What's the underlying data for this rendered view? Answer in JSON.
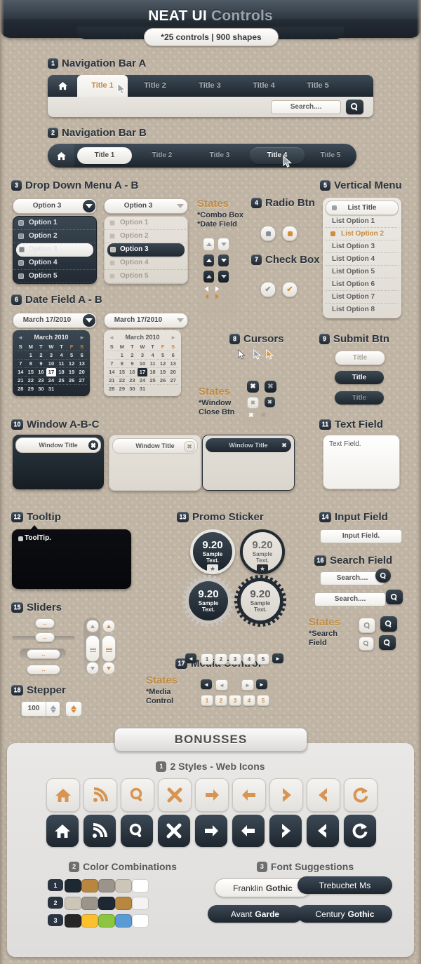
{
  "header": {
    "title_main": "NEAT UI",
    "title_sub": "Controls",
    "pill": "*25 controls | 900 shapes"
  },
  "sections": {
    "nav_a": {
      "num": "1",
      "label": "Navigation Bar A"
    },
    "nav_b": {
      "num": "2",
      "label": "Navigation Bar B"
    },
    "dropdown": {
      "num": "3",
      "label": "Drop Down Menu A - B"
    },
    "radio": {
      "num": "4",
      "label": "Radio Btn"
    },
    "vertical_menu": {
      "num": "5",
      "label": "Vertical Menu"
    },
    "date_field": {
      "num": "6",
      "label": "Date Field  A - B"
    },
    "check_box": {
      "num": "7",
      "label": "Check Box"
    },
    "cursors": {
      "num": "8",
      "label": "Cursors"
    },
    "submit": {
      "num": "9",
      "label": "Submit Btn"
    },
    "window": {
      "num": "10",
      "label": "Window A-B-C"
    },
    "text_field": {
      "num": "11",
      "label": "Text Field"
    },
    "tooltip": {
      "num": "12",
      "label": "Tooltip"
    },
    "promo": {
      "num": "13",
      "label": "Promo Sticker"
    },
    "input_field": {
      "num": "14",
      "label": "Input Field"
    },
    "sliders": {
      "num": "15",
      "label": "Sliders"
    },
    "search_field": {
      "num": "16",
      "label": "Search Field"
    },
    "media": {
      "num": "17",
      "label": "Media Control"
    },
    "stepper": {
      "num": "18",
      "label": "Stepper"
    }
  },
  "states_labels": {
    "combo": {
      "title": "States",
      "lines": "*Combo Box\n*Date Field"
    },
    "window_close": {
      "title": "States",
      "lines": "*Window\nClose Btn"
    },
    "search": {
      "title": "States",
      "lines": "*Search\nField"
    },
    "media": {
      "title": "States",
      "lines": "*Media\nControl"
    }
  },
  "nav_a": {
    "tabs": [
      "Title 1",
      "Title 2",
      "Title 3",
      "Title 4",
      "Title 5"
    ],
    "active_index": 0,
    "search_placeholder": "Search....",
    "home_icon": "home-icon",
    "search_icon": "search-icon"
  },
  "nav_b": {
    "tabs": [
      "Title 1",
      "Title 2",
      "Title 3",
      "Title 4",
      "Title 5"
    ],
    "light_index": 0,
    "dark_index": 3,
    "home_icon": "home-icon"
  },
  "dropdown": {
    "selected": "Option 3",
    "options": [
      "Option 1",
      "Option 2",
      "Option 3",
      "Option 4",
      "Option 5"
    ],
    "selected_index": 2
  },
  "date_field": {
    "value": "March 17/2010",
    "month_title": "March 2010",
    "weekdays": [
      "S",
      "M",
      "T",
      "W",
      "T",
      "F",
      "S"
    ],
    "weekend_cols": [
      5,
      6
    ],
    "today": 17,
    "weeks": [
      [
        "",
        "1",
        "2",
        "3",
        "4",
        "5",
        "6"
      ],
      [
        "7",
        "8",
        "9",
        "10",
        "11",
        "12",
        "13"
      ],
      [
        "14",
        "15",
        "16",
        "17",
        "18",
        "19",
        "20"
      ],
      [
        "21",
        "22",
        "23",
        "24",
        "25",
        "26",
        "27"
      ],
      [
        "28",
        "29",
        "30",
        "31",
        "",
        "",
        ""
      ]
    ]
  },
  "vertical_menu": {
    "title": "List Title",
    "items": [
      "List Option 1",
      "List Option 2",
      "List Option 3",
      "List Option 4",
      "List Option 5",
      "List Option 6",
      "List Option 7",
      "List Option 8"
    ],
    "active_index": 1,
    "active_color": "#c2873d"
  },
  "submit": {
    "buttons": [
      "Title",
      "Title",
      "Title"
    ]
  },
  "windows": {
    "titles": [
      "Window Title",
      "Window Title",
      "Window Title"
    ],
    "close_icon": "close-icon"
  },
  "text_field": {
    "value": "Text Field."
  },
  "tooltip": {
    "text": "ToolTip."
  },
  "promo": {
    "stickers": [
      {
        "value": "9.20",
        "text": "Sample\nText."
      },
      {
        "value": "9.20",
        "text": "Sample\nText."
      },
      {
        "value": "9.20",
        "text": "Sample\nText."
      },
      {
        "value": "9.20",
        "text": "Sample\nText."
      }
    ]
  },
  "input_field": {
    "value": "Input Field."
  },
  "search_field": {
    "placeholder": "Search....",
    "icon": "search-icon"
  },
  "stepper": {
    "value": "100"
  },
  "media": {
    "prev_icon": "prev-icon",
    "next_icon": "next-icon",
    "pages": [
      "1",
      "2",
      "3",
      "4",
      "5"
    ]
  },
  "bonus": {
    "tag": "BONUSSES",
    "web_icons": {
      "num": "1",
      "label": "2 Styles - Web Icons",
      "icons": [
        "home-icon",
        "rss-icon",
        "search-icon",
        "close-icon",
        "arrow-right-icon",
        "arrow-left-icon",
        "chevron-right-icon",
        "chevron-left-icon",
        "refresh-icon"
      ]
    },
    "colors": {
      "num": "2",
      "label": "Color Combinations",
      "rows": [
        {
          "num": "1",
          "swatches": [
            "#1d2833",
            "#b8863f",
            "#9c948a",
            "#cdc5b8",
            "#ffffff"
          ]
        },
        {
          "num": "2",
          "swatches": [
            "#cdc5b8",
            "#9c948a",
            "#1d2833",
            "#b8863f",
            "#f4f3f1"
          ]
        },
        {
          "num": "3",
          "swatches": [
            "#262626",
            "#fbc02d",
            "#8cc63f",
            "#5b9bd5",
            "#ffffff"
          ]
        }
      ]
    },
    "fonts": {
      "num": "3",
      "label": "Font Suggestions",
      "items": [
        {
          "a": "Franklin",
          "b": "Gothic",
          "style": "lt"
        },
        {
          "a": "Trebuchet",
          "b": "Ms",
          "style": "dk"
        },
        {
          "a": "Avant",
          "b": "Garde",
          "style": "dk"
        },
        {
          "a": "Century",
          "b": "Gothic",
          "style": "dk"
        }
      ]
    }
  }
}
